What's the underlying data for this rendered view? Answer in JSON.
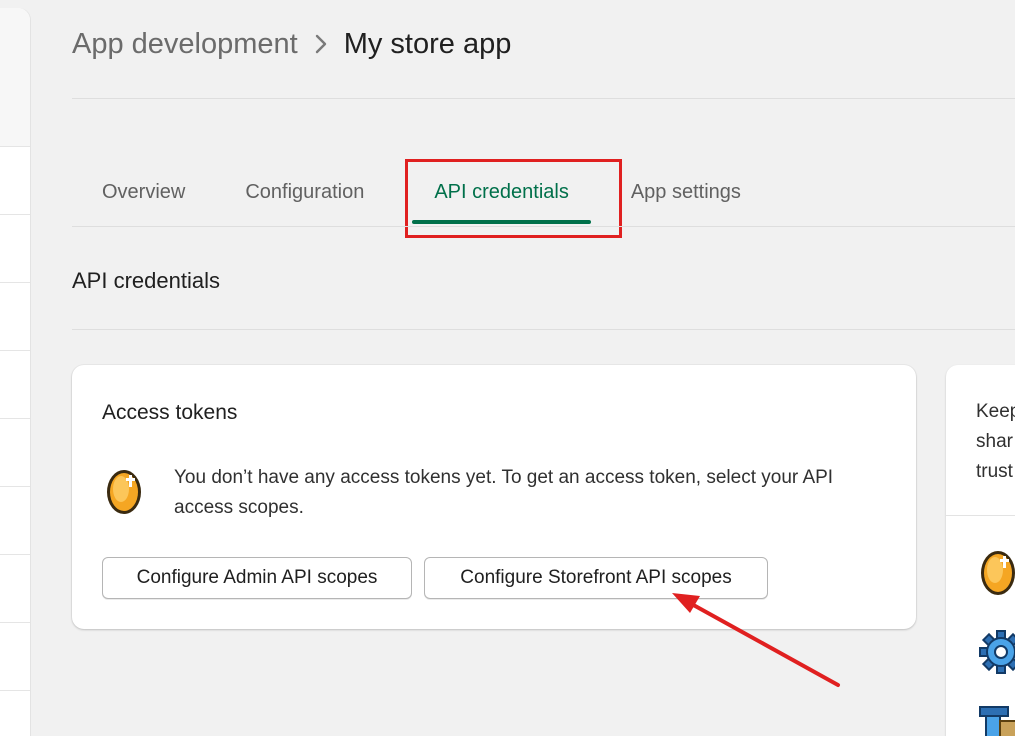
{
  "breadcrumb": {
    "parent": "App development",
    "current": "My store app"
  },
  "tabs": [
    {
      "label": "Overview",
      "active": false
    },
    {
      "label": "Configuration",
      "active": false
    },
    {
      "label": "API credentials",
      "active": true
    },
    {
      "label": "App settings",
      "active": false
    }
  ],
  "section": {
    "title": "API credentials"
  },
  "access_tokens": {
    "title": "Access tokens",
    "message": "You don’t have any access tokens yet. To get an access token, select your API access scopes.",
    "admin_button": "Configure Admin API scopes",
    "storefront_button": "Configure Storefront API scopes",
    "icon": "coin-icon"
  },
  "side_card": {
    "lines": [
      "Keep",
      "shar",
      "trust"
    ],
    "icons": [
      "coin-icon",
      "gear-icon",
      "building-icon"
    ]
  },
  "colors": {
    "accent": "#00704a",
    "annotation": "#e02020",
    "background": "#f1f1f1"
  }
}
